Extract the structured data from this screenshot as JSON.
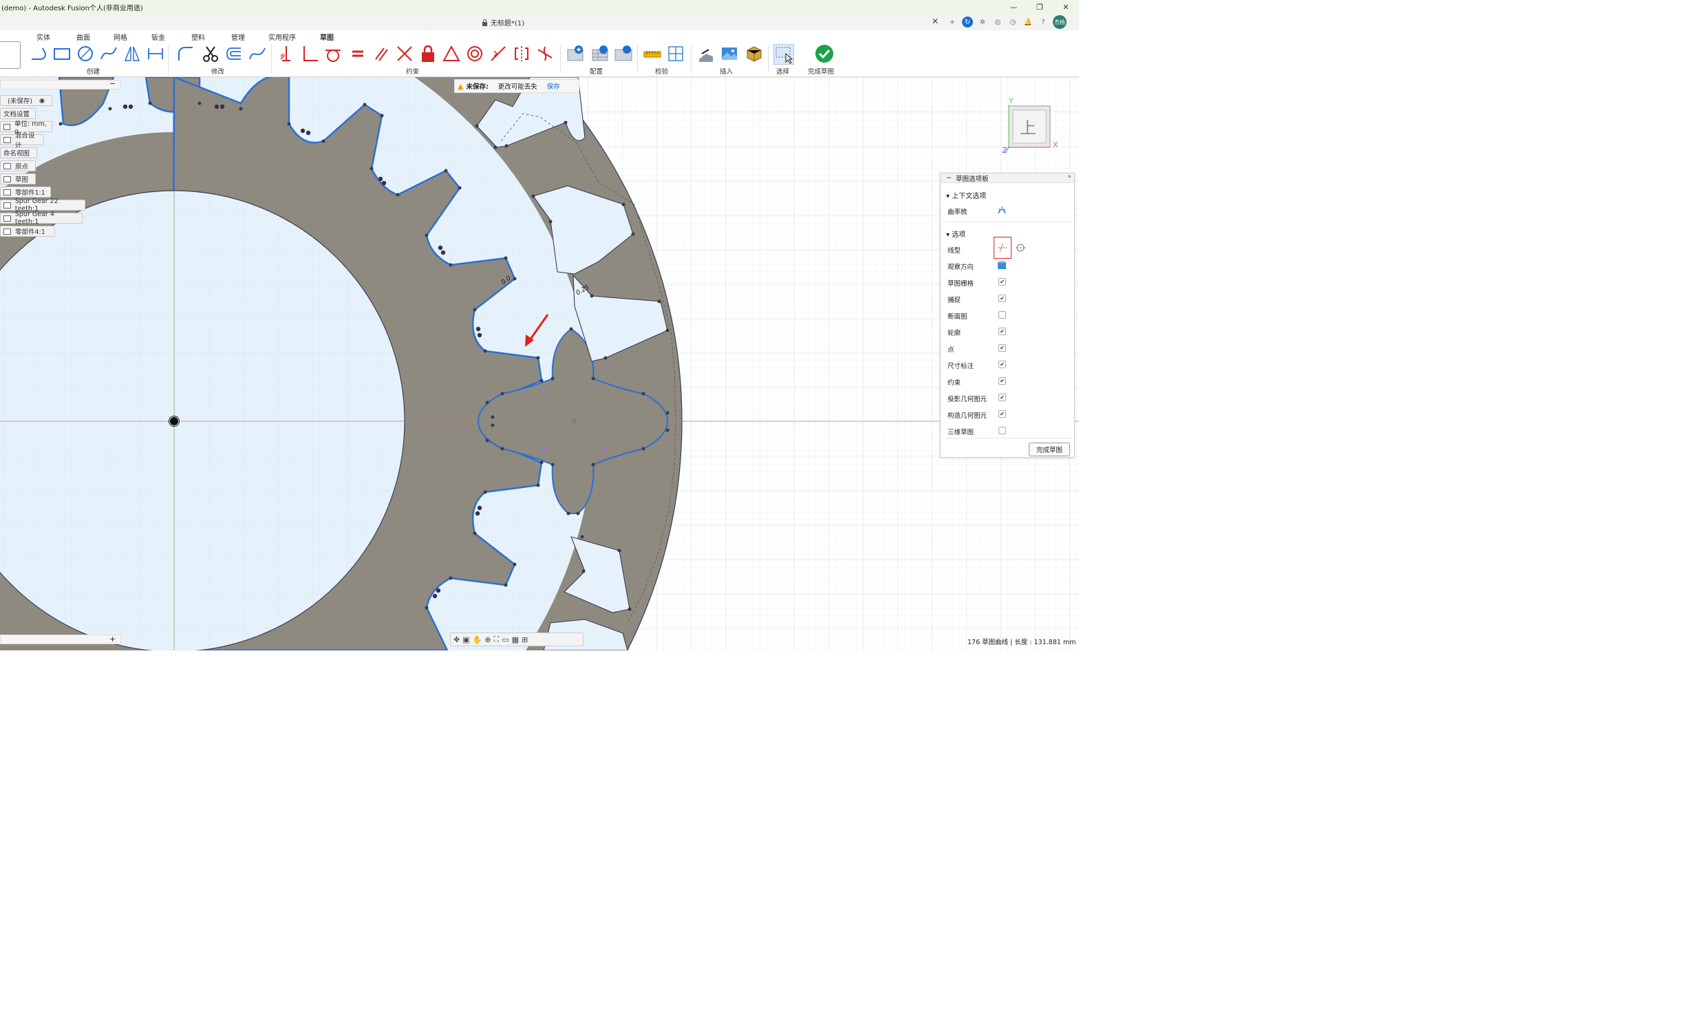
{
  "window": {
    "title": "(demo) - Autodesk Fusion个人(非商业用途)",
    "controls": [
      "—",
      "❐",
      "✕"
    ]
  },
  "document": {
    "title": "无标题*(1)",
    "close": "✕"
  },
  "user": {
    "initials": "杰杨"
  },
  "ribbon_tabs": [
    "实体",
    "曲面",
    "网格",
    "钣金",
    "塑料",
    "管理",
    "实用程序",
    "草图"
  ],
  "ribbon_groups": {
    "create": "创建",
    "modify": "修改",
    "constraints": "约束",
    "configure": "配置",
    "inspect": "检验",
    "insert": "插入",
    "select": "选择",
    "finish": "完成草图"
  },
  "browser": {
    "collapse": "−",
    "items": [
      "(未保存)",
      "文档设置",
      "单位: mm, g",
      "混合设计",
      "命名视图",
      "原点",
      "草图",
      "零部件1:1",
      "Spur Gear 22 teeth:1",
      "Spur Gear 4 teeth:1",
      "零部件4:1"
    ],
    "bottom_add": "+"
  },
  "notification": {
    "label": "未保存:",
    "message": "更改可能丢失",
    "action": "保存"
  },
  "dimensions": [
    "0.0",
    "0.25"
  ],
  "viewcube": {
    "face": "上",
    "axis_y": "Y",
    "axis_x": "X",
    "axis_z": "Z"
  },
  "palette": {
    "title": "草图选项板",
    "context_section": "上下文选项",
    "curvature_comb": "曲率梳",
    "options_section": "选项",
    "rows": [
      {
        "label": "线型",
        "type": "icons"
      },
      {
        "label": "观察方向",
        "type": "icon"
      },
      {
        "label": "草图栅格",
        "checked": true
      },
      {
        "label": "捕捉",
        "checked": true
      },
      {
        "label": "断面图",
        "checked": false
      },
      {
        "label": "轮廓",
        "checked": true
      },
      {
        "label": "点",
        "checked": true
      },
      {
        "label": "尺寸标注",
        "checked": true
      },
      {
        "label": "约束",
        "checked": true
      },
      {
        "label": "投影几何图元",
        "checked": true
      },
      {
        "label": "构造几何图元",
        "checked": true
      },
      {
        "label": "三维草图",
        "checked": false
      }
    ],
    "finish_button": "完成草图"
  },
  "status_bar": {
    "text": "176 草图曲线 | 长度 : 131.881 mm"
  },
  "colors": {
    "gear_fill": "#8e8a7f",
    "sketch_blue": "#2a6fd6",
    "grid_bg": "#e6f2fb",
    "axis_red": "#e07070",
    "axis_green": "#6cc06c",
    "arrow_red": "#e3201b",
    "check_green": "#1ba34a"
  }
}
